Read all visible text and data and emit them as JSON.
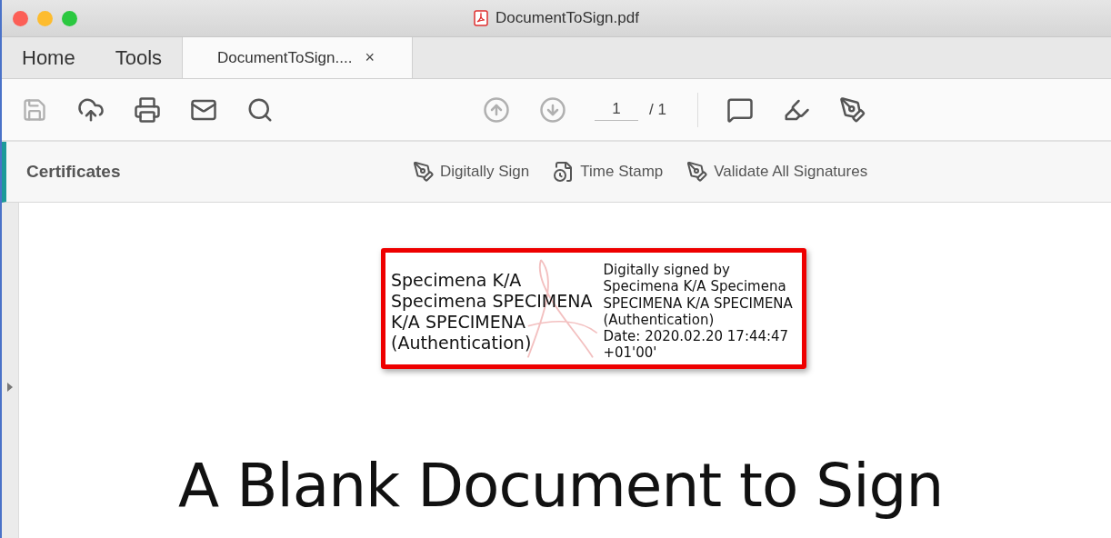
{
  "window": {
    "title": "DocumentToSign.pdf"
  },
  "tabs": [
    {
      "label": "Home",
      "selected": false
    },
    {
      "label": "Tools",
      "selected": false
    },
    {
      "label": "DocumentToSign....",
      "selected": true,
      "close": "×"
    }
  ],
  "page_nav": {
    "current": "1",
    "total": "/ 1"
  },
  "tool_panel": {
    "title": "Certificates",
    "actions": [
      {
        "kind": "sign",
        "label": "Digitally Sign"
      },
      {
        "kind": "stamp",
        "label": "Time Stamp"
      },
      {
        "kind": "validate",
        "label": "Validate All Signatures"
      }
    ]
  },
  "signature": {
    "name_lines": [
      "Specimena K/A",
      "Specimena SPECIMENA",
      "K/A SPECIMENA",
      "(Authentication)"
    ],
    "detail_lines": [
      "Digitally signed by",
      "Specimena K/A Specimena",
      "SPECIMENA K/A SPECIMENA",
      "(Authentication)",
      "Date: 2020.02.20 17:44:47",
      "+01'00'"
    ]
  },
  "document": {
    "heading": "A Blank Document to Sign"
  }
}
